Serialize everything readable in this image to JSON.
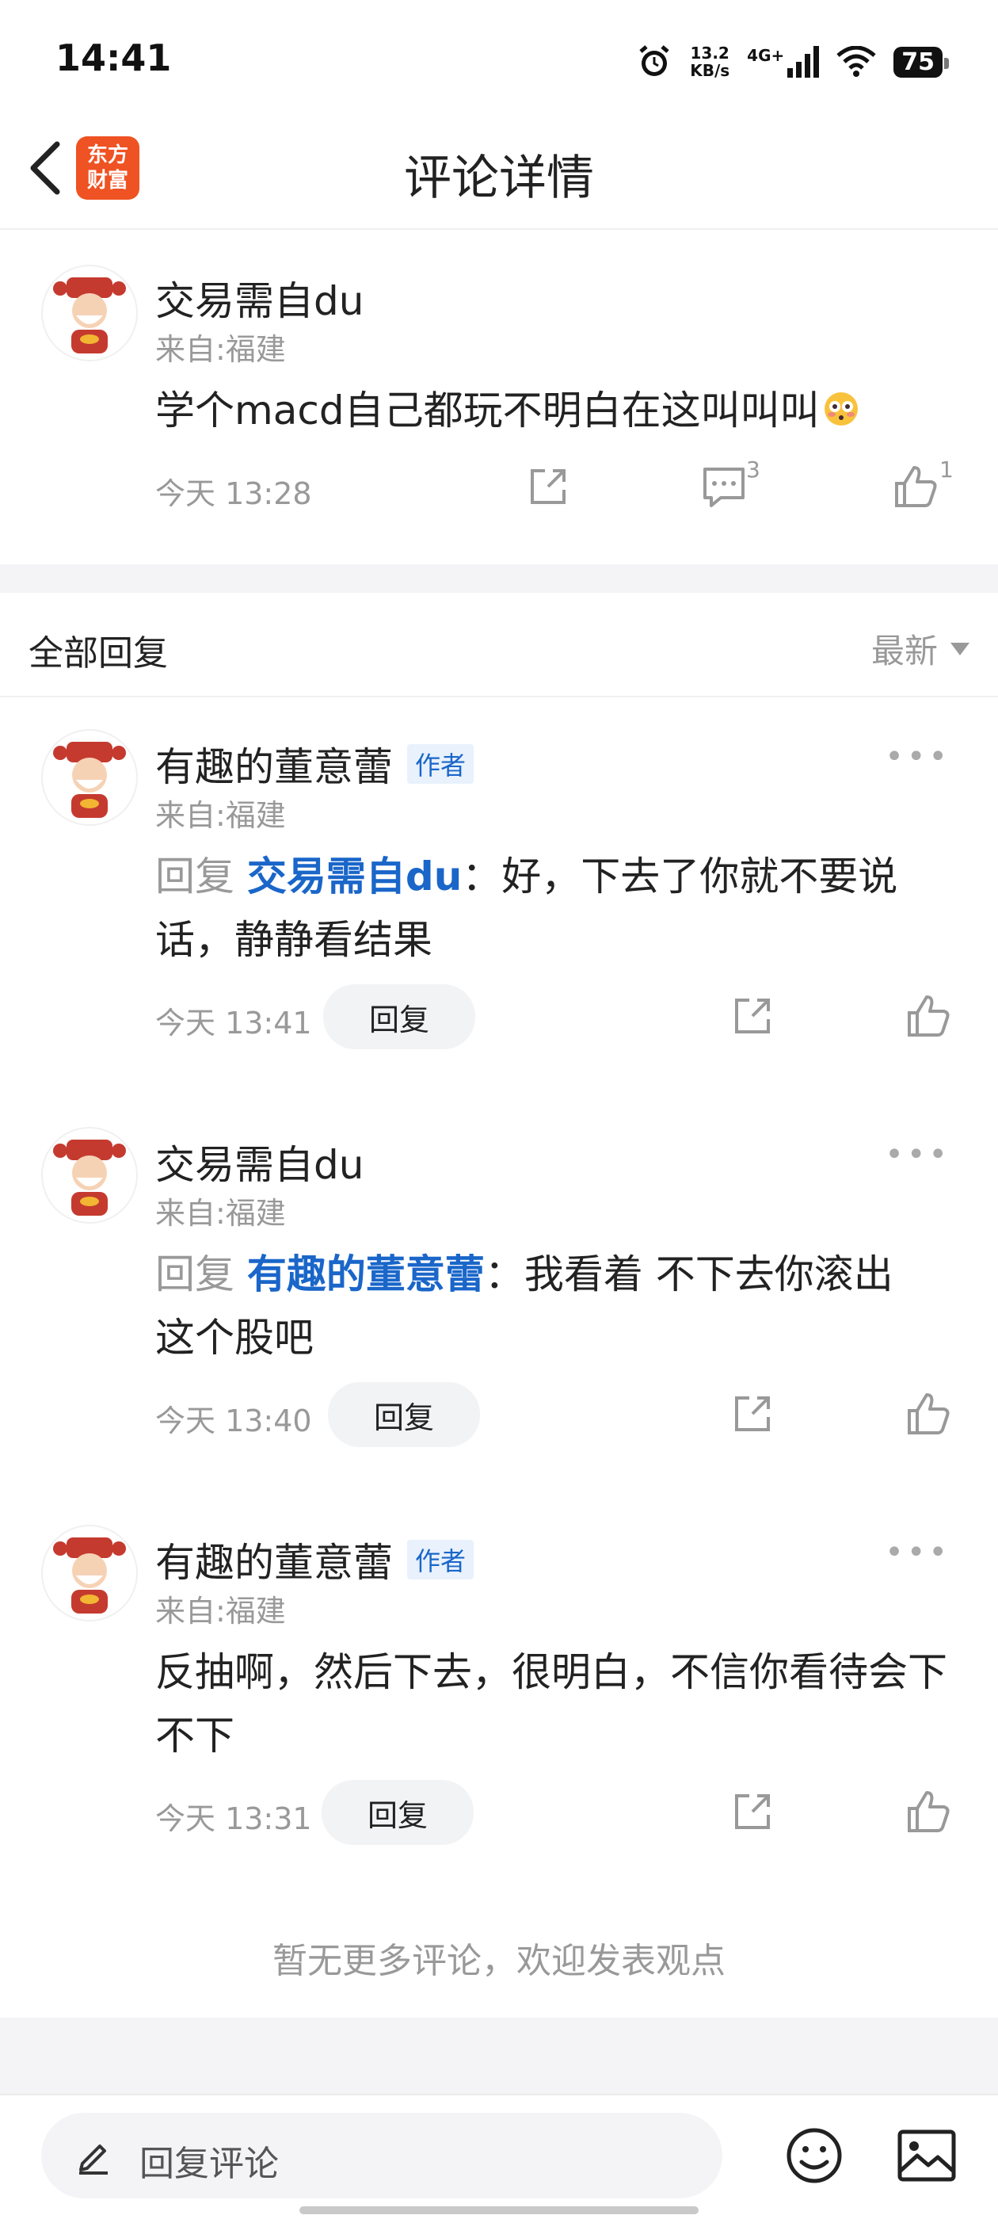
{
  "status_bar": {
    "time": "14:41",
    "speed_value": "13.2",
    "speed_unit": "KB/s",
    "network": "4G+",
    "battery": "75"
  },
  "nav": {
    "title": "评论详情",
    "logo_line1": "东方",
    "logo_line2": "财富"
  },
  "post": {
    "author": "交易需自du",
    "location": "来自:福建",
    "content": "学个macd自己都玩不明白在这叫叫叫",
    "time": "今天 13:28",
    "comment_count": "3",
    "like_count": "1"
  },
  "replies_header": {
    "title": "全部回复",
    "sort": "最新"
  },
  "replies": [
    {
      "author": "有趣的董意蕾",
      "badge": "作者",
      "location": "来自:福建",
      "prefix": "回复 ",
      "target": "交易需自du",
      "content": "：好，下去了你就不要说话，静静看结果",
      "time": "今天 13:41",
      "reply_label": "回复"
    },
    {
      "author": "交易需自du",
      "badge": "",
      "location": "来自:福建",
      "prefix": "回复 ",
      "target": "有趣的董意蕾",
      "content": "：我看着 不下去你滚出这个股吧",
      "time": "今天 13:40",
      "reply_label": "回复"
    },
    {
      "author": "有趣的董意蕾",
      "badge": "作者",
      "location": "来自:福建",
      "prefix": "",
      "target": "",
      "content": "反抽啊，然后下去，很明白，不信你看待会下不下",
      "time": "今天 13:31",
      "reply_label": "回复"
    }
  ],
  "footer_note": "暂无更多评论，欢迎发表观点",
  "bottom_bar": {
    "placeholder": "回复评论"
  },
  "colors": {
    "accent_blue": "#1a66c9",
    "brand_orange": "#ef5223",
    "muted_gray": "#999999"
  }
}
